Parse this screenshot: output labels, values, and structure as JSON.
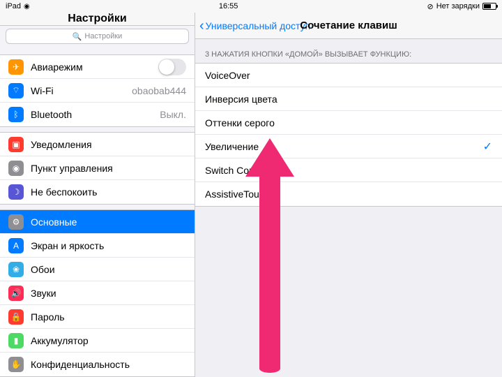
{
  "status": {
    "device": "iPad",
    "time": "16:55",
    "charge": "Нет зарядки"
  },
  "sidebar": {
    "title": "Настройки",
    "search_placeholder": "Настройки",
    "g1": [
      {
        "label": "Авиарежим"
      },
      {
        "label": "Wi-Fi",
        "val": "obaobab444"
      },
      {
        "label": "Bluetooth",
        "val": "Выкл."
      }
    ],
    "g2": [
      {
        "label": "Уведомления"
      },
      {
        "label": "Пункт управления"
      },
      {
        "label": "Не беспокоить"
      }
    ],
    "g3": [
      {
        "label": "Основные"
      },
      {
        "label": "Экран и яркость"
      },
      {
        "label": "Обои"
      },
      {
        "label": "Звуки"
      },
      {
        "label": "Пароль"
      },
      {
        "label": "Аккумулятор"
      },
      {
        "label": "Конфиденциальность"
      }
    ]
  },
  "detail": {
    "back": "Универсальный доступ",
    "title": "Сочетание клавиш",
    "section": "3 НАЖАТИЯ КНОПКИ «ДОМОЙ» ВЫЗЫВАЕТ ФУНКЦИЮ:",
    "options": [
      {
        "label": "VoiceOver"
      },
      {
        "label": "Инверсия цвета"
      },
      {
        "label": "Оттенки серого"
      },
      {
        "label": "Увеличение",
        "checked": true
      },
      {
        "label": "Switch Control"
      },
      {
        "label": "AssistiveTouch"
      }
    ]
  }
}
